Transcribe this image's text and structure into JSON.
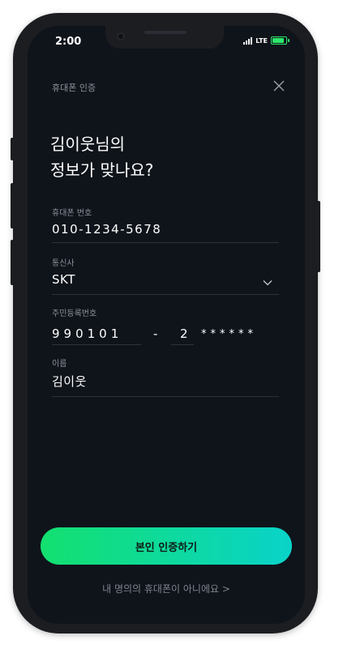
{
  "status": {
    "time": "2:00",
    "network": "LTE"
  },
  "nav": {
    "title": "휴대폰 인증"
  },
  "headline": {
    "line1": "김이웃님의",
    "line2": "정보가 맞나요?"
  },
  "fields": {
    "phone": {
      "label": "휴대폰 번호",
      "value": "010-1234-5678"
    },
    "carrier": {
      "label": "통신사",
      "value": "SKT"
    },
    "rrn": {
      "label": "주민등록번호",
      "front": "990101",
      "dash": "-",
      "back_first": "2",
      "mask": "******"
    },
    "name": {
      "label": "이름",
      "value": "김이웃"
    }
  },
  "cta": {
    "label": "본인 인증하기"
  },
  "link": {
    "label": "내 명의의 휴대폰이 아니에요  >"
  },
  "colors": {
    "accent_start": "#13e06f",
    "accent_end": "#09d3c9",
    "screen_bg": "#0f141b"
  },
  "icons": {
    "close": "close-icon",
    "chevron": "chevron-down-icon"
  }
}
